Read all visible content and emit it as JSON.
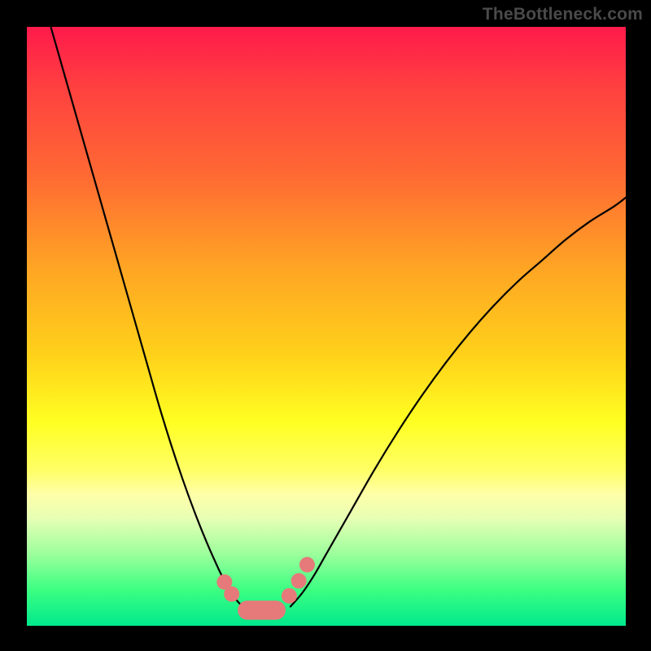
{
  "watermark": "TheBottleneck.com",
  "colors": {
    "frame": "#000000",
    "gradient_top": "#ff1a4b",
    "gradient_bottom": "#00e88c",
    "curve": "#000000",
    "marker": "#e67a7a"
  },
  "chart_data": {
    "type": "line",
    "title": "",
    "xlabel": "",
    "ylabel": "",
    "xlim": [
      0,
      100
    ],
    "ylim": [
      0,
      100
    ],
    "series": [
      {
        "name": "left-curve",
        "x": [
          4,
          6,
          8,
          10,
          12,
          14,
          16,
          18,
          20,
          22,
          24,
          26,
          28,
          30,
          32,
          33,
          34,
          35,
          36
        ],
        "y": [
          100,
          93,
          86,
          79,
          72,
          65,
          58,
          51,
          44,
          37,
          30.5,
          24.5,
          19,
          14,
          9.5,
          7.5,
          5.8,
          4.3,
          3.2
        ]
      },
      {
        "name": "right-curve",
        "x": [
          44,
          46,
          48,
          50,
          54,
          58,
          62,
          66,
          70,
          74,
          78,
          82,
          86,
          90,
          94,
          98,
          100
        ],
        "y": [
          3.2,
          5.5,
          8.5,
          12,
          19,
          26,
          32.5,
          38.5,
          44,
          49,
          53.5,
          57.5,
          61,
          64.5,
          67.5,
          70,
          71.5
        ]
      }
    ],
    "markers": [
      {
        "x": 33.0,
        "y": 7.3
      },
      {
        "x": 34.2,
        "y": 5.3
      },
      {
        "x": 43.8,
        "y": 5.0
      },
      {
        "x": 45.4,
        "y": 7.5
      },
      {
        "x": 46.8,
        "y": 10.2
      }
    ],
    "flat_segment": {
      "x0": 35.2,
      "x1": 43.2,
      "y": 2.6,
      "thickness": 3.2
    }
  }
}
